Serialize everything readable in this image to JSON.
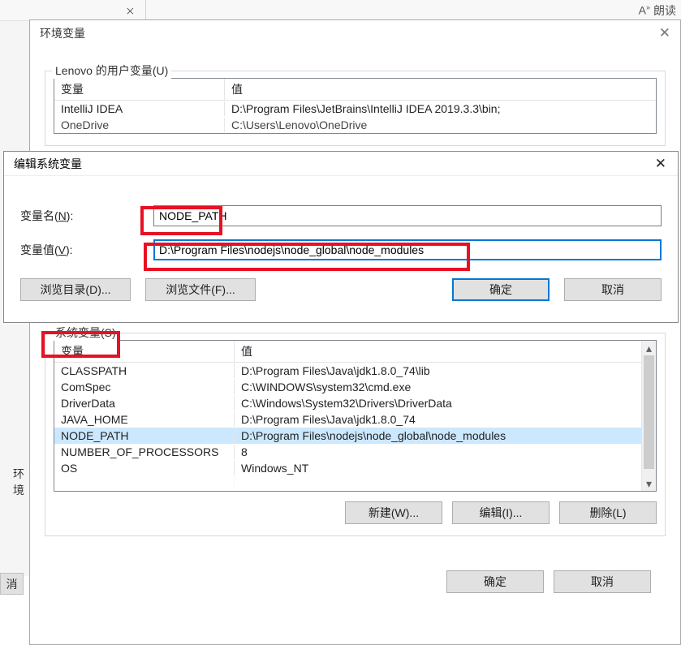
{
  "bg_top": {
    "read_aloud": "朗读",
    "icon_name": "read-aloud"
  },
  "bg_left": {
    "env_label": "环境",
    "cancel": "消"
  },
  "env_dialog": {
    "title": "环境变量",
    "user_group_title": "Lenovo 的用户变量(U)",
    "sys_group_title": "系统变量(S)",
    "columns": {
      "var": "变量",
      "val": "值"
    },
    "user_rows": [
      {
        "var": "IntelliJ IDEA",
        "val": "D:\\Program Files\\JetBrains\\IntelliJ IDEA 2019.3.3\\bin;"
      },
      {
        "var": "OneDrive",
        "val": "C:\\Users\\Lenovo\\OneDrive"
      }
    ],
    "sys_rows": [
      {
        "var": "CLASSPATH",
        "val": "D:\\Program Files\\Java\\jdk1.8.0_74\\lib"
      },
      {
        "var": "ComSpec",
        "val": "C:\\WINDOWS\\system32\\cmd.exe"
      },
      {
        "var": "DriverData",
        "val": "C:\\Windows\\System32\\Drivers\\DriverData"
      },
      {
        "var": "JAVA_HOME",
        "val": "D:\\Program Files\\Java\\jdk1.8.0_74"
      },
      {
        "var": "NODE_PATH",
        "val": "D:\\Program Files\\nodejs\\node_global\\node_modules",
        "selected": true
      },
      {
        "var": "NUMBER_OF_PROCESSORS",
        "val": "8"
      },
      {
        "var": "OS",
        "val": "Windows_NT"
      },
      {
        "var": "",
        "val": ""
      }
    ],
    "buttons": {
      "new": "新建(W)...",
      "edit": "编辑(I)...",
      "delete": "删除(L)",
      "ok": "确定",
      "cancel": "取消"
    }
  },
  "edit_dialog": {
    "title": "编辑系统变量",
    "name_label_pre": "变量名(",
    "name_label_ul": "N",
    "name_label_post": "):",
    "value_label_pre": "变量值(",
    "value_label_ul": "V",
    "value_label_post": "):",
    "name_value": "NODE_PATH",
    "value_value": "D:\\Program Files\\nodejs\\node_global\\node_modules",
    "buttons": {
      "browse_dir": "浏览目录(D)...",
      "browse_file": "浏览文件(F)...",
      "ok": "确定",
      "cancel": "取消"
    }
  }
}
